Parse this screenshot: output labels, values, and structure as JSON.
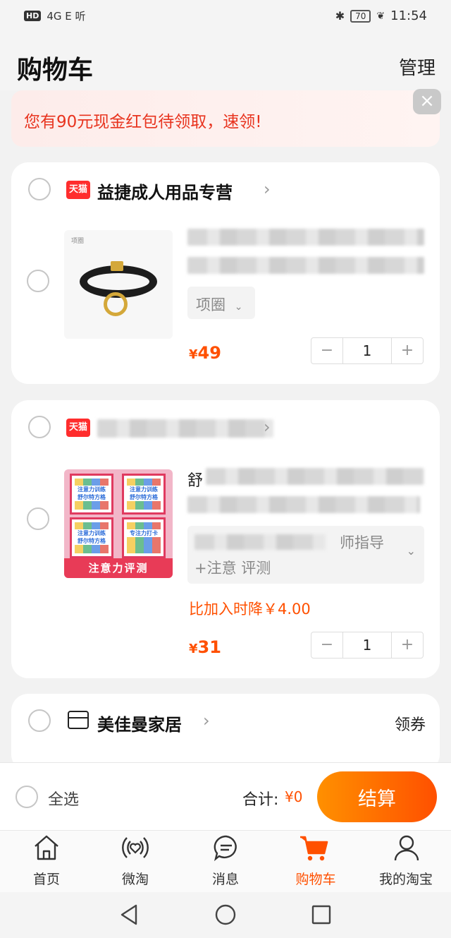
{
  "status_bar": {
    "left_chip": "HD",
    "left_text": "4G  E  听",
    "battery": "70",
    "time": "11:54"
  },
  "header": {
    "title": "购物车",
    "manage": "管理"
  },
  "banner": {
    "text": "您有90元现金红包待领取，速领!",
    "close": "×"
  },
  "stores": [
    {
      "badge": "天猫",
      "name": "益捷成人用品专营",
      "item": {
        "thumb_caption": "项圈",
        "sku": "项圈",
        "price_symbol": "¥",
        "price": "49",
        "qty": "1"
      }
    },
    {
      "badge": "天猫",
      "name": "",
      "item": {
        "thumb_label": "注意力评测",
        "tile_texts": [
          "注意力训练 舒尔特方格",
          "注意力训练 舒尔特方格",
          "注意力训练 舒尔特方格",
          "专注力打卡"
        ],
        "title_prefix": "舒",
        "sku_suffix": "师指导",
        "sku_line2": "+注意  评测",
        "drop_note": "比加入时降￥4.00",
        "price_symbol": "¥",
        "price": "31",
        "qty": "1"
      }
    },
    {
      "name": "美佳曼家居",
      "coupon": "领券"
    }
  ],
  "checkout": {
    "select_all": "全选",
    "total_label": "合计:",
    "total_value": "¥0",
    "pay": "结算"
  },
  "tabs": [
    {
      "label": "首页",
      "icon": "home-icon"
    },
    {
      "label": "微淘",
      "icon": "feed-icon"
    },
    {
      "label": "消息",
      "icon": "message-icon"
    },
    {
      "label": "购物车",
      "icon": "cart-icon",
      "active": true
    },
    {
      "label": "我的淘宝",
      "icon": "profile-icon"
    }
  ],
  "colors": {
    "accent": "#ff5000",
    "tmall": "#ff2d2d",
    "banner_text": "#e8341f"
  }
}
